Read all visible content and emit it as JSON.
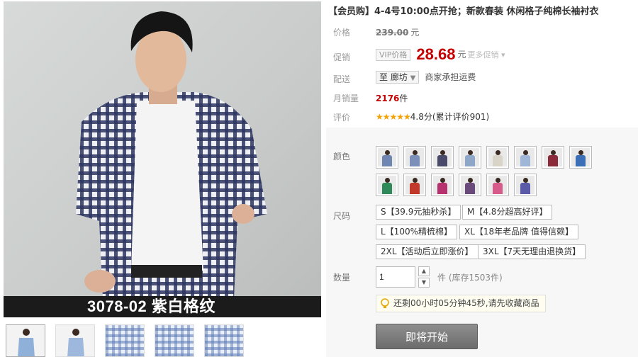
{
  "product": {
    "title": "【会员购】4-4号10:00点开抢；新款春装 休闲格子纯棉长袖衬衣",
    "image_caption": "3078-02  紫白格纹"
  },
  "labels": {
    "price": "价格",
    "promo": "促销",
    "shipping": "配送",
    "monthly_sales": "月销量",
    "rating": "评价",
    "color": "颜色",
    "size": "尺码",
    "quantity": "数量"
  },
  "price": {
    "original": "239.00",
    "unit": "元",
    "vip_tag": "VIP价格",
    "promo_price": "28.68",
    "more_promo": "更多促销"
  },
  "shipping": {
    "destination": "至 廊坊",
    "note": "商家承担运费"
  },
  "sales": {
    "count": "2176",
    "unit": "件"
  },
  "rating": {
    "stars": "★★★★★",
    "score_text": "4.8分(累计评价901)",
    "score": 4.8
  },
  "colors": [
    {
      "shirt": "#6f86b3"
    },
    {
      "shirt": "#7b8fb8"
    },
    {
      "shirt": "#4a4a6a"
    },
    {
      "shirt": "#8ea7c8"
    },
    {
      "shirt": "#d9d4c8"
    },
    {
      "shirt": "#9fb6d6"
    },
    {
      "shirt": "#8a2a3a"
    },
    {
      "shirt": "#3d6fb6"
    },
    {
      "shirt": "#2f8a5a"
    },
    {
      "shirt": "#c0392b"
    },
    {
      "shirt": "#b5326e"
    },
    {
      "shirt": "#6a4a7a"
    },
    {
      "shirt": "#d85a8a"
    },
    {
      "shirt": "#5a5aa8"
    }
  ],
  "sizes": [
    "S【39.9元抽秒杀】",
    "M【4.8分超高好评】",
    "L【100%精梳棉】",
    "XL【18年老品牌 值得信赖】",
    "2XL【活动后立即涨价】",
    "3XL【7天无理由退换货】"
  ],
  "quantity": {
    "value": "1",
    "stock": "件 (库存1503件)"
  },
  "tip": "还剩00小时05分钟45秒,请先收藏商品",
  "buy_button": "即将开始"
}
